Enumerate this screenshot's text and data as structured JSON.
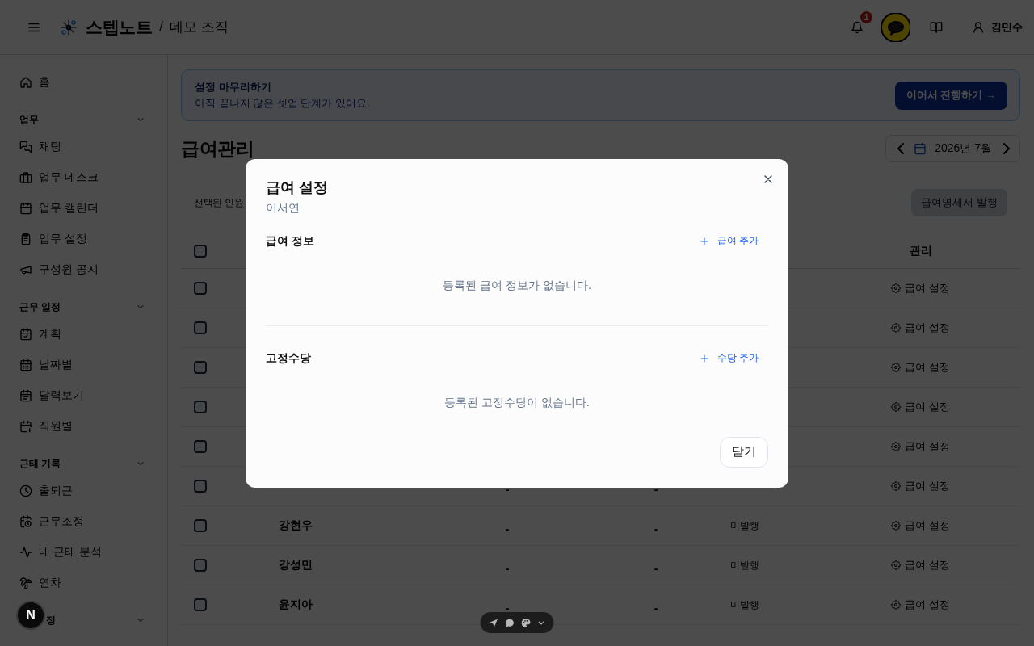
{
  "header": {
    "brand": "스텝노트",
    "separator": "/",
    "organization": "데모 조직",
    "notification_count": "1",
    "user_name": "김민수"
  },
  "sidebar": {
    "home": {
      "label": "홈",
      "selected": false
    },
    "sections": [
      {
        "label": "업무",
        "expanded": true,
        "items": [
          {
            "label": "채팅",
            "selected": false
          },
          {
            "label": "업무 데스크",
            "selected": false
          },
          {
            "label": "업무 캘린더",
            "selected": false
          },
          {
            "label": "업무 설정",
            "selected": false
          },
          {
            "label": "구성원 공지",
            "selected": false
          }
        ]
      },
      {
        "label": "근무 일정",
        "expanded": true,
        "items": [
          {
            "label": "계획",
            "selected": false
          },
          {
            "label": "날짜별",
            "selected": false
          },
          {
            "label": "달력보기",
            "selected": false
          },
          {
            "label": "직원별",
            "selected": false
          }
        ]
      },
      {
        "label": "근태 기록",
        "expanded": true,
        "items": [
          {
            "label": "출퇴근",
            "selected": false
          },
          {
            "label": "근무조정",
            "selected": false
          },
          {
            "label": "내 근태 분석",
            "selected": false
          },
          {
            "label": "연차",
            "selected": false
          }
        ]
      },
      {
        "label": "정",
        "expanded": true
      }
    ]
  },
  "banner": {
    "title": "설정 마무리하기",
    "message": "아직 끝나지 않은 셋업 단계가 있어요.",
    "button": "이어서 진행하기 →"
  },
  "page": {
    "title": "급여관리",
    "month": "2026년 7월"
  },
  "toolbar": {
    "selection_text": "선택된 인원",
    "issue_button": {
      "label": "급여명세서 발행",
      "disabled": true
    }
  },
  "table": {
    "header": {
      "checked": false,
      "manage": "관리"
    },
    "rows": [
      {
        "checked": false,
        "action": "급여 설정"
      },
      {
        "checked": false,
        "action": "급여 설정"
      },
      {
        "checked": false,
        "action": "급여 설정"
      },
      {
        "checked": false,
        "action": "급여 설정"
      },
      {
        "checked": false,
        "action": "급여 설정"
      },
      {
        "checked": false,
        "column_3": "-",
        "column_4": "-",
        "action": "급여 설정"
      },
      {
        "checked": false,
        "name": "강현우",
        "column_3": "-",
        "column_4": "-",
        "status": "미발행",
        "action": "급여 설정"
      },
      {
        "checked": false,
        "name": "강성민",
        "column_3": "-",
        "column_4": "-",
        "status": "미발행",
        "action": "급여 설정"
      },
      {
        "checked": false,
        "name": "윤지아",
        "column_3": "-",
        "column_4": "-",
        "status": "미발행",
        "action": "급여 설정"
      }
    ]
  },
  "dialog": {
    "title": "급여 설정",
    "subtitle": "이서연",
    "sections": [
      {
        "title": "급여 정보",
        "add_button": "급여 추가",
        "empty_text": "등록된 급여 정보가 없습니다."
      },
      {
        "title": "고정수당",
        "add_button": "수당 추가",
        "empty_text": "등록된 고정수당이 없습니다."
      }
    ],
    "close_button": "닫기"
  },
  "dev_badge": {
    "letter": "N"
  }
}
